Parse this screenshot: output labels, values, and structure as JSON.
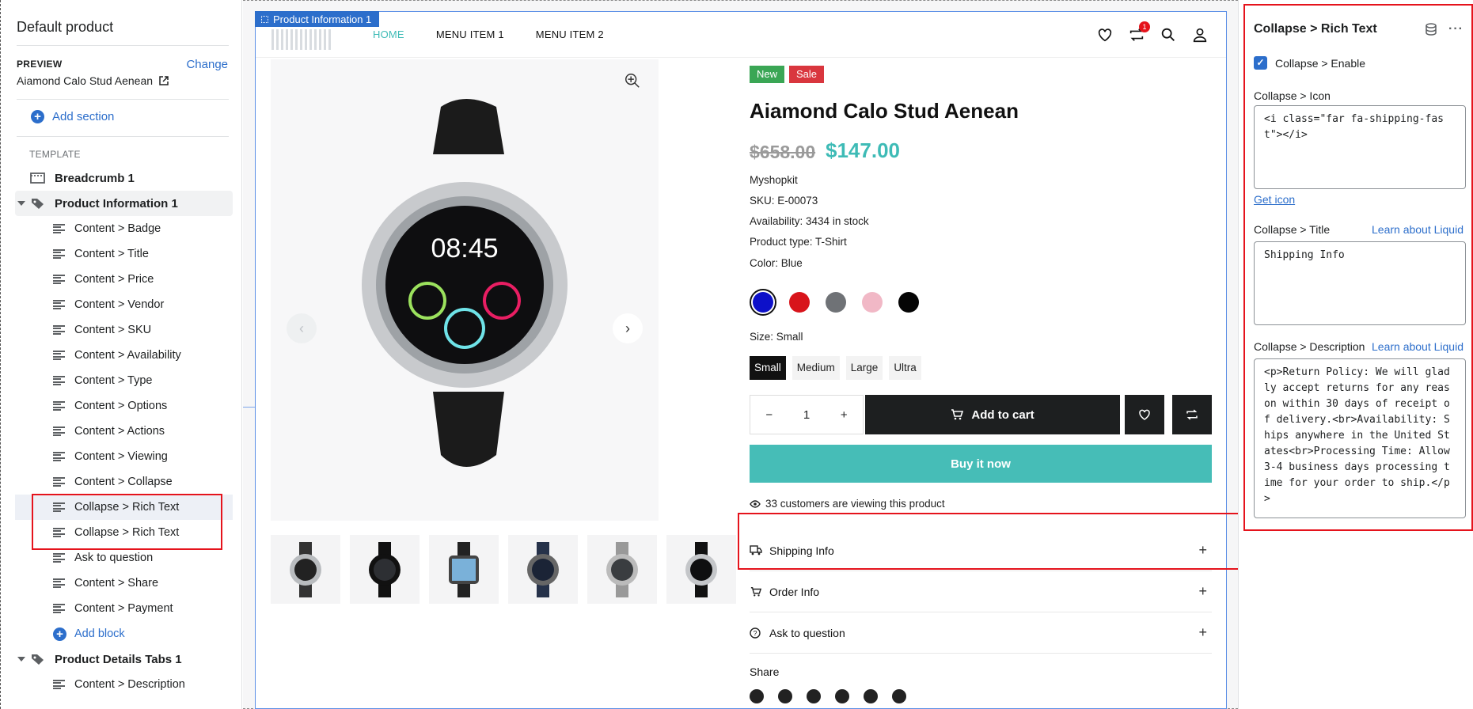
{
  "sidebar": {
    "title": "Default product",
    "preview_label": "PREVIEW",
    "change_label": "Change",
    "preview_value": "Aiamond Calo Stud Aenean",
    "add_section": "Add section",
    "template_label": "TEMPLATE",
    "items": [
      {
        "label": "Breadcrumb 1",
        "level": 0,
        "icon": "breadcrumb-icon"
      },
      {
        "label": "Product Information 1",
        "level": 0,
        "icon": "tag-icon",
        "expanded": true
      },
      {
        "label": "Content > Badge",
        "level": 1
      },
      {
        "label": "Content > Title",
        "level": 1
      },
      {
        "label": "Content > Price",
        "level": 1
      },
      {
        "label": "Content > Vendor",
        "level": 1
      },
      {
        "label": "Content > SKU",
        "level": 1
      },
      {
        "label": "Content > Availability",
        "level": 1
      },
      {
        "label": "Content > Type",
        "level": 1
      },
      {
        "label": "Content > Options",
        "level": 1
      },
      {
        "label": "Content > Actions",
        "level": 1
      },
      {
        "label": "Content > Viewing",
        "level": 1
      },
      {
        "label": "Content > Collapse",
        "level": 1
      },
      {
        "label": "Collapse > Rich Text",
        "level": 1,
        "selected": true
      },
      {
        "label": "Collapse > Rich Text",
        "level": 1
      },
      {
        "label": "Ask to question",
        "level": 1
      },
      {
        "label": "Content > Share",
        "level": 1
      },
      {
        "label": "Content > Payment",
        "level": 1
      },
      {
        "label": "Add block",
        "level": 1,
        "type": "add"
      },
      {
        "label": "Product Details Tabs 1",
        "level": 0,
        "icon": "tag-icon",
        "expanded": true
      },
      {
        "label": "Content > Description",
        "level": 1
      }
    ]
  },
  "preview": {
    "frame_tag": "Product Information 1",
    "nav": [
      "HOME",
      "MENU ITEM 1",
      "MENU ITEM 2"
    ],
    "cart_count": "1",
    "badges": [
      {
        "label": "New",
        "color": "#3aa655"
      },
      {
        "label": "Sale",
        "color": "#d9363e"
      }
    ],
    "title": "Aiamond Calo Stud Aenean",
    "price_old": "$658.00",
    "price_new": "$147.00",
    "vendor": "Myshopkit",
    "sku": "SKU: E-00073",
    "availability": "Availability: 3434 in stock",
    "product_type": "Product type: T-Shirt",
    "color_label": "Color: Blue",
    "colors": [
      "#0d10c9",
      "#d8141b",
      "#6f7276",
      "#f1b8c6",
      "#050505"
    ],
    "size_label": "Size: Small",
    "sizes": [
      "Small",
      "Medium",
      "Large",
      "Ultra"
    ],
    "qty": "1",
    "add_to_cart": "Add to cart",
    "buy_now": "Buy it now",
    "viewing": "33 customers are viewing this product",
    "collapses": [
      "Shipping Info",
      "Order Info",
      "Ask to question"
    ],
    "share_label": "Share",
    "accent": "#3ebbb6"
  },
  "panel": {
    "title": "Collapse > Rich Text",
    "enable_label": "Collapse > Enable",
    "icon_label": "Collapse > Icon",
    "icon_value": "<i class=\"far fa-shipping-fast\"></i>",
    "get_icon": "Get icon",
    "title_label": "Collapse > Title",
    "learn_liquid": "Learn about Liquid",
    "title_value": "Shipping Info",
    "desc_label": "Collapse > Description",
    "desc_value": "<p>Return Policy: We will gladly accept returns for any reason within 30 days of receipt of delivery.<br>Availability: Ships anywhere in the United States<br>Processing Time: Allow 3-4 business days processing time for your order to ship.</p>"
  }
}
